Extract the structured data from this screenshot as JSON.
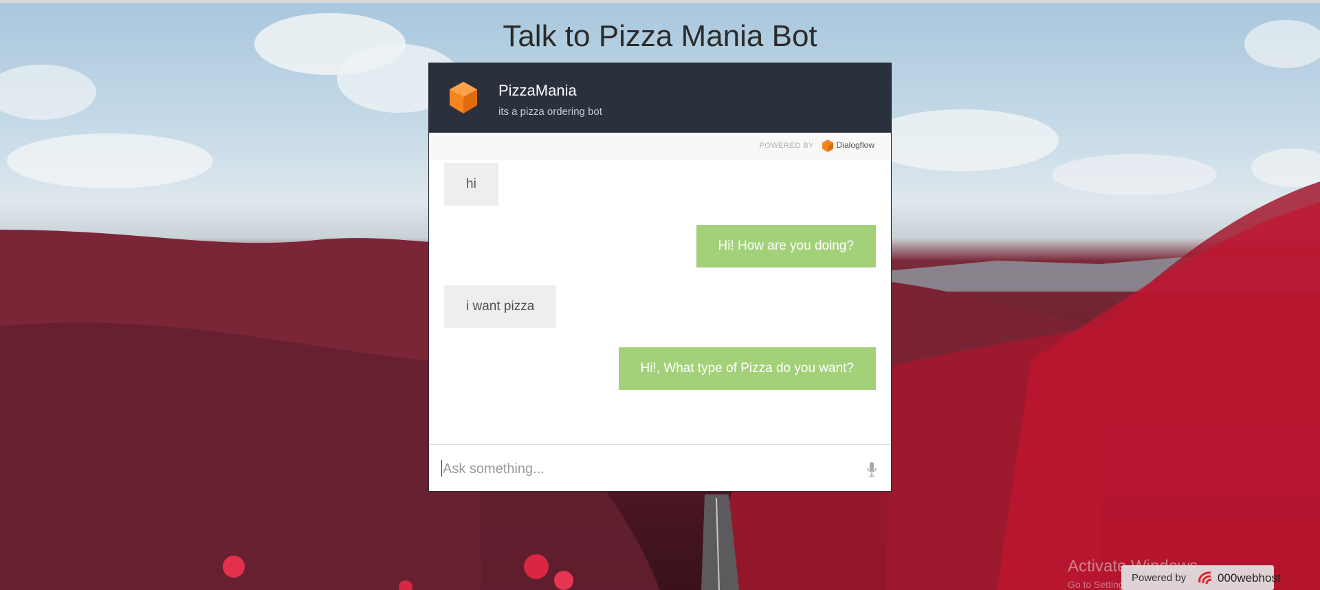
{
  "page": {
    "title": "Talk to Pizza Mania Bot"
  },
  "chat": {
    "bot_name": "PizzaMania",
    "bot_description": "its a pizza ordering bot",
    "powered_by_label": "POWERED BY",
    "powered_by_brand": "Dialogflow",
    "messages": [
      {
        "sender": "user",
        "text": "hi"
      },
      {
        "sender": "bot",
        "text": "Hi! How are you doing?"
      },
      {
        "sender": "user",
        "text": "i want pizza"
      },
      {
        "sender": "bot",
        "text": "Hi!, What type of Pizza do you want?"
      }
    ],
    "input": {
      "placeholder": "Ask something...",
      "value": ""
    },
    "mic_icon": "microphone-icon",
    "logo_icon": "dialogflow-cube-icon"
  },
  "overlay": {
    "activate_windows": "Activate Windows",
    "activate_sub": "Go to Settings",
    "host_powered_by": "Powered by",
    "host_name": "000webhost"
  },
  "colors": {
    "header_bg": "#2b303d",
    "user_bubble": "#eeeeee",
    "bot_bubble": "#a3d17a",
    "logo_orange": "#f5841f"
  }
}
